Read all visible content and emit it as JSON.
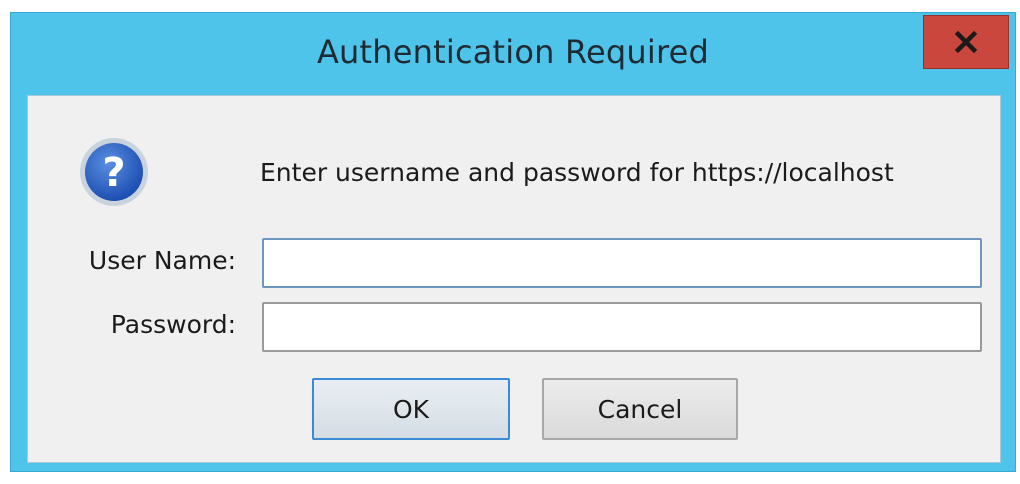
{
  "window": {
    "title": "Authentication Required",
    "close_label": "x"
  },
  "dialog": {
    "icon": "question-icon",
    "message": "Enter username and password for https://localhost",
    "username_label": "User Name:",
    "username_value": "",
    "password_label": "Password:",
    "password_value": "",
    "ok_label": "OK",
    "cancel_label": "Cancel"
  },
  "colors": {
    "titlebar": "#4fc4ea",
    "close_button": "#c9473d",
    "client_background": "#f0f0f0",
    "focus_border": "#3c8ad6"
  }
}
